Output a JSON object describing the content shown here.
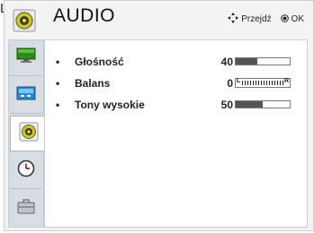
{
  "cut_letter": "L",
  "header": {
    "title": "AUDIO",
    "hints": {
      "move_label": "Przejdź",
      "ok_label": "OK",
      "move_icon": "four-way-arrows-icon",
      "ok_icon": "ok-dot-icon"
    }
  },
  "sidebar": {
    "items": [
      {
        "name": "picture",
        "icon": "monitor-icon",
        "active": false
      },
      {
        "name": "screen",
        "icon": "screen-settings-icon",
        "active": false
      },
      {
        "name": "audio",
        "icon": "speaker-icon",
        "active": true
      },
      {
        "name": "time",
        "icon": "clock-icon",
        "active": false
      },
      {
        "name": "options",
        "icon": "briefcase-icon",
        "active": false
      }
    ]
  },
  "settings": [
    {
      "bullet": "•",
      "label": "Głośność",
      "value": "40",
      "level": 0.4,
      "type": "level"
    },
    {
      "bullet": "•",
      "label": "Balans",
      "value": "0",
      "level": 0.5,
      "type": "balance",
      "left_mark": "L",
      "right_mark": "R"
    },
    {
      "bullet": "•",
      "label": "Tony wysokie",
      "value": "50",
      "level": 0.5,
      "type": "level"
    }
  ],
  "colors": {
    "accent_green": "#2e8a1c",
    "speaker_yellow": "#c9c53a",
    "sidebar_bg": "#d7dde3"
  }
}
